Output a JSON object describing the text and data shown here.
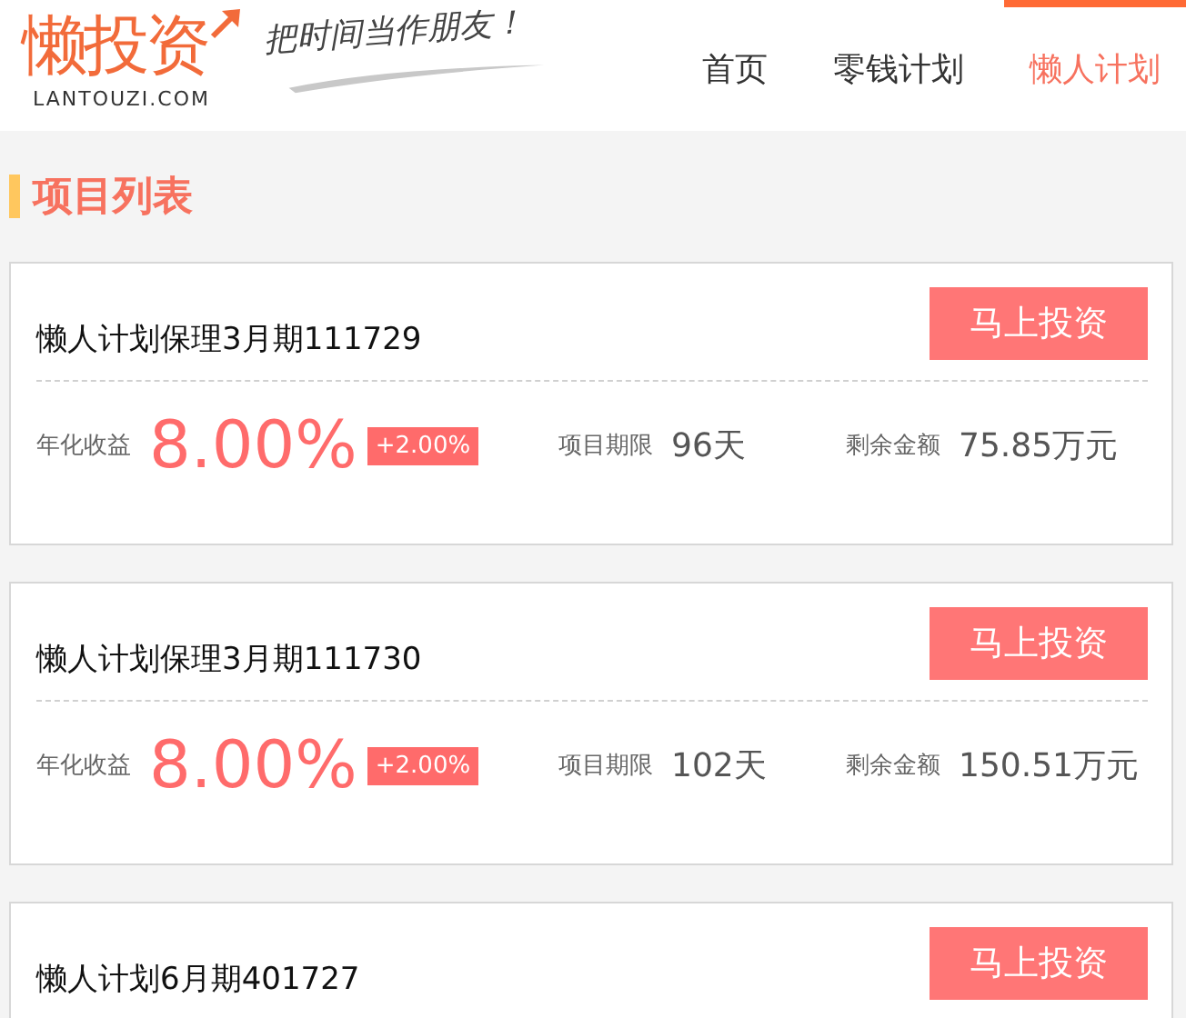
{
  "header": {
    "logo": "懒投资",
    "logo_domain": "LANTOUZI.COM",
    "slogan": "把时间当作朋友！",
    "nav": [
      {
        "label": "首页",
        "selected": false
      },
      {
        "label": "零钱计划",
        "selected": false
      },
      {
        "label": "懒人计划",
        "selected": true
      }
    ]
  },
  "section_title": "项目列表",
  "projects": [
    {
      "name": "懒人计划保理3月期111729",
      "button": "马上投资",
      "rate_label": "年化收益",
      "rate": "8.00%",
      "bonus": "+2.00%",
      "term_label": "项目期限",
      "term": "96天",
      "remain_label": "剩余金额",
      "remain": "75.85万元"
    },
    {
      "name": "懒人计划保理3月期111730",
      "button": "马上投资",
      "rate_label": "年化收益",
      "rate": "8.00%",
      "bonus": "+2.00%",
      "term_label": "项目期限",
      "term": "102天",
      "remain_label": "剩余金额",
      "remain": "150.51万元"
    },
    {
      "name": "懒人计划6月期401727",
      "button": "马上投资"
    }
  ]
}
